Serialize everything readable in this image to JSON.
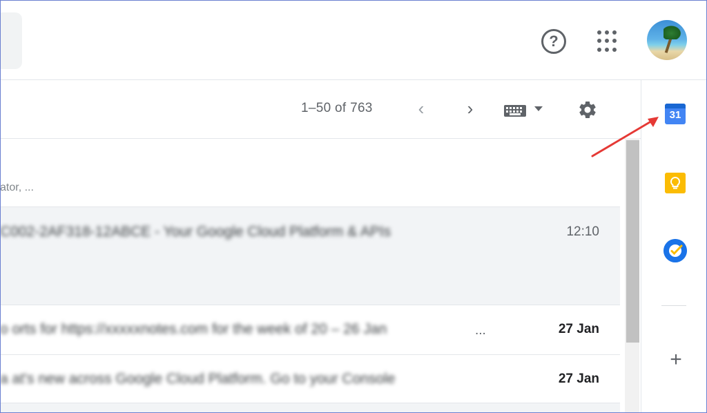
{
  "header": {
    "help_icon": "question-mark-circle",
    "help_glyph": "?",
    "apps_icon": "apps-grid",
    "avatar_icon": "beach-palm-avatar"
  },
  "toolbar": {
    "pagination_text": "1–50 of 763",
    "prev_glyph": "‹",
    "next_glyph": "›",
    "keyboard_icon": "keyboard",
    "settings_icon": "gear"
  },
  "inbox": {
    "tab_subtext": "ator, ...",
    "rows": [
      {
        "snippet": "C002-2AF318-12ABCE - Your Google Cloud Platform & APIs ",
        "date": "12:10",
        "unread": false
      },
      {
        "snippet": "o orts for https://xxxxxnotes.com for the week of 20 – 26 Jan",
        "ellipsis": "...",
        "date": "27 Jan",
        "unread": true
      },
      {
        "snippet": "a at's new across Google Cloud Platform. Go to your Console ",
        "date": "27 Jan",
        "unread": true
      }
    ]
  },
  "side_panel": {
    "calendar_number": "31",
    "calendar_icon": "calendar",
    "keep_icon": "lightbulb",
    "tasks_icon": "check-circle",
    "add_glyph": "+",
    "add_icon": "plus"
  },
  "annotation": {
    "arrow_color": "#e53935"
  },
  "colors": {
    "accent_blue": "#4285f4",
    "keep_yellow": "#fbbc04",
    "icon_gray": "#5f6368"
  }
}
